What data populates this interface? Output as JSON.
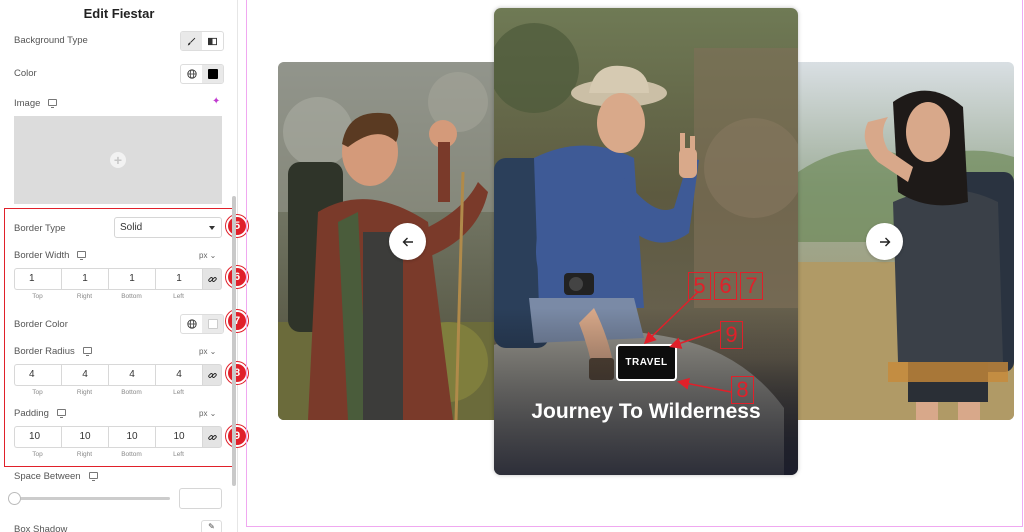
{
  "panel": {
    "title": "Edit Fiestar",
    "background_type_label": "Background Type",
    "color_label": "Color",
    "image_label": "Image",
    "border_type_label": "Border Type",
    "border_type_value": "Solid",
    "border_width": {
      "label": "Border Width",
      "unit": "px",
      "values": [
        "1",
        "1",
        "1",
        "1"
      ]
    },
    "border_color_label": "Border Color",
    "border_radius": {
      "label": "Border Radius",
      "unit": "px",
      "values": [
        "4",
        "4",
        "4",
        "4"
      ]
    },
    "padding": {
      "label": "Padding",
      "unit": "px",
      "values": [
        "10",
        "10",
        "10",
        "10"
      ]
    },
    "side_labels": [
      "Top",
      "Right",
      "Bottom",
      "Left"
    ],
    "space_between_label": "Space Between",
    "box_shadow_label": "Box Shadow"
  },
  "badges": [
    "5",
    "6",
    "7",
    "8",
    "9"
  ],
  "preview": {
    "tag": "TRAVEL",
    "title": "Journey To Wilderness",
    "annotations": [
      "5",
      "6",
      "7",
      "9",
      "8"
    ]
  },
  "colors": {
    "accent_red": "#e0202a",
    "frame_pink": "#f0a8f0",
    "sparkle": "#c13bd0"
  },
  "icons": {
    "prev": "arrow-left-icon",
    "next": "arrow-right-icon",
    "link": "link-icon",
    "monitor": "monitor-icon",
    "globe": "globe-icon"
  }
}
